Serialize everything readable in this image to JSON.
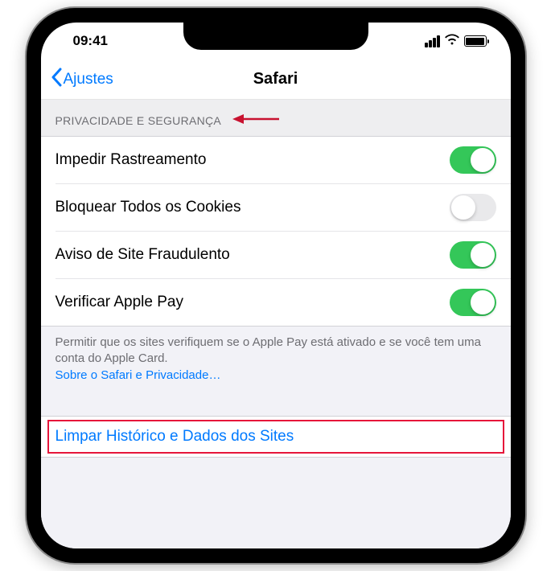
{
  "status": {
    "time": "09:41"
  },
  "nav": {
    "back_label": "Ajustes",
    "title": "Safari"
  },
  "section": {
    "header": "PRIVACIDADE E SEGURANÇA"
  },
  "rows": {
    "prevent_tracking": {
      "label": "Impedir Rastreamento",
      "on": true
    },
    "block_cookies": {
      "label": "Bloquear Todos os Cookies",
      "on": false
    },
    "fraud_warning": {
      "label": "Aviso de Site Fraudulento",
      "on": true
    },
    "apple_pay": {
      "label": "Verificar Apple Pay",
      "on": true
    }
  },
  "footer": {
    "text": "Permitir que os sites verifiquem se o Apple Pay está ativado e se você tem uma conta do Apple Card.",
    "link": "Sobre o Safari e Privacidade…"
  },
  "action": {
    "clear_history": "Limpar Histórico e Dados dos Sites"
  },
  "colors": {
    "accent": "#007aff",
    "toggle_on": "#34c759",
    "annotation": "#e6163a"
  }
}
